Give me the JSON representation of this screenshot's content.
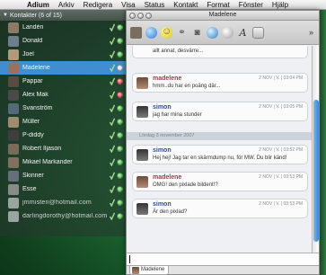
{
  "menubar": {
    "items": [
      "Adium",
      "Arkiv",
      "Redigera",
      "Visa",
      "Status",
      "Kontakt",
      "Format",
      "Fönster",
      "Hjälp"
    ]
  },
  "contacts": {
    "group_label": "Kontakter (6 of 15)",
    "rows": [
      {
        "name": "Landén",
        "status": "green"
      },
      {
        "name": "Donald",
        "status": "green"
      },
      {
        "name": "Joel",
        "status": "green"
      },
      {
        "name": "Madelene",
        "status": "white",
        "selected": true
      },
      {
        "name": "Pappar",
        "status": "red"
      },
      {
        "name": "Alex Mak",
        "status": "red"
      },
      {
        "name": "Svanström",
        "status": "green"
      },
      {
        "name": "Müller",
        "status": "green"
      },
      {
        "name": "P-diddy",
        "status": "green"
      },
      {
        "name": "Robert Iljason",
        "status": "green"
      },
      {
        "name": "Mikael Markander",
        "status": "green"
      },
      {
        "name": "Skinner",
        "status": "green"
      },
      {
        "name": "Esse",
        "status": "green"
      },
      {
        "name": "jmmisten@hotmail.com",
        "status": "green"
      },
      {
        "name": "darlingdorothy@hotmail.com",
        "status": "green"
      }
    ]
  },
  "chat": {
    "title": "Madelene",
    "toolbar_icons": [
      "contact-avatar",
      "blue-status",
      "smiley",
      "link",
      "camera",
      "globe",
      "gray-sphere",
      "font",
      "card",
      "more"
    ],
    "partial_text": "allt annat, desvärre...",
    "date_divider": "Lördag 3 november 2007",
    "messages": [
      {
        "sender": "madelene",
        "time": "2 NOV | V. | 03:04 PM",
        "text": "hmm..du har en poäng där..."
      },
      {
        "sender": "simon",
        "time": "2 NOV | V. | 03:05 PM",
        "text": "jag har mina stunder"
      },
      {
        "sender": "simon",
        "time": "2 NOV | V. | 03:52 PM",
        "text": "Hej hej! Jag tar en skärmdump nu, för MW. Du blir känd!"
      },
      {
        "sender": "madelene",
        "time": "2 NOV | V. | 03:53 PM",
        "text": "OMG! den pixlade bildent!?"
      },
      {
        "sender": "simon",
        "time": "2 NOV | V. | 03:53 PM",
        "text": "Är den pixlad?"
      }
    ],
    "tab_label": "Madelene"
  }
}
